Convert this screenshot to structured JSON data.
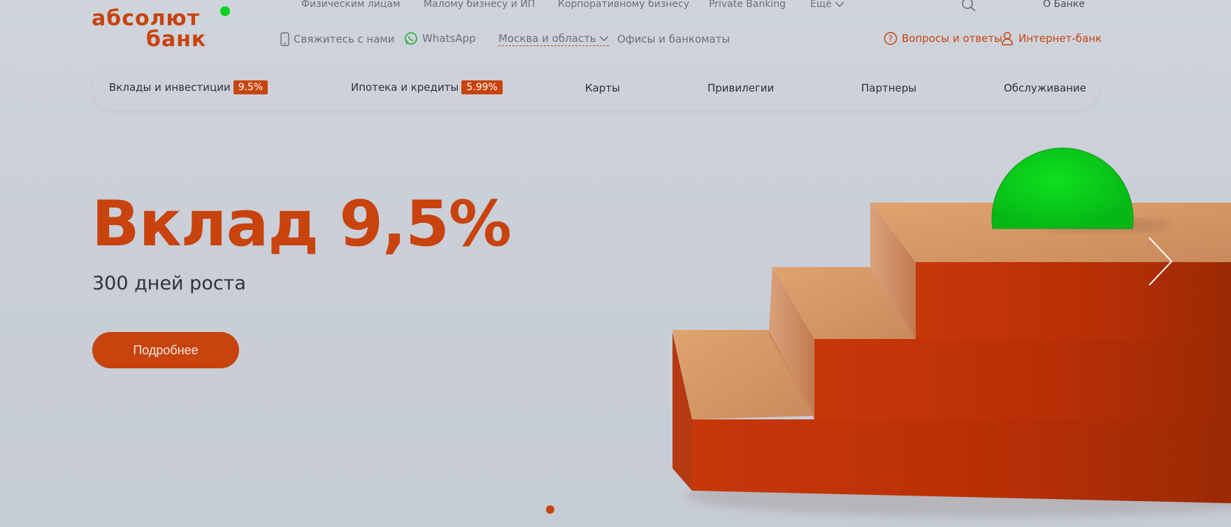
{
  "logo": {
    "line1": "абсолют",
    "line2": "банк",
    "dot_color": "#0bd21c"
  },
  "top_nav": {
    "items": [
      "Физическим лицам",
      "Малому бизнесу и ИП",
      "Корпоративному бизнесу",
      "Private Banking",
      "Ещё"
    ],
    "about": "О Банке"
  },
  "second_nav": {
    "contact": "Свяжитесь с нами",
    "whatsapp": "WhatsApp",
    "region": "Москва и область",
    "offices": "Офисы и банкоматы",
    "faq": "Вопросы и ответы",
    "internet_bank": "Интернет-банк"
  },
  "categories": [
    {
      "label": "Вклады и инвестиции",
      "badge": "9.5%"
    },
    {
      "label": "Ипотека и кредиты",
      "badge": "5.99%"
    },
    {
      "label": "Карты"
    },
    {
      "label": "Привилегии"
    },
    {
      "label": "Партнеры"
    },
    {
      "label": "Обслуживание"
    }
  ],
  "hero": {
    "title": "Вклад 9,5%",
    "subtitle": "300 дней роста",
    "button": "Подробнее"
  },
  "colors": {
    "accent": "#c8430e",
    "coin": "#08c818",
    "background": "#cbd0d9"
  },
  "icons": [
    "search-icon",
    "phone-icon",
    "whatsapp-icon",
    "chevron-down-icon",
    "question-icon",
    "user-icon",
    "chevron-right-icon"
  ]
}
